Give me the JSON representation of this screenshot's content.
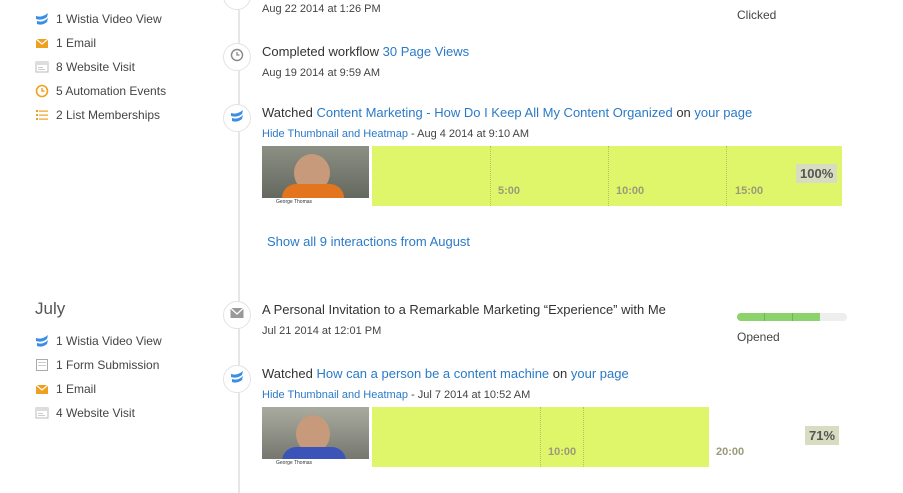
{
  "summary_august": [
    {
      "icon": "wistia-icon",
      "label": "1 Wistia Video View"
    },
    {
      "icon": "email-icon",
      "label": "1 Email"
    },
    {
      "icon": "website-visit-icon",
      "label": "8 Website Visit"
    },
    {
      "icon": "clock-icon",
      "label": "5 Automation Events"
    },
    {
      "icon": "list-icon",
      "label": "2 List Memberships"
    }
  ],
  "july": {
    "month": "July",
    "summary": [
      {
        "icon": "wistia-icon",
        "label": "1 Wistia Video View"
      },
      {
        "icon": "form-icon",
        "label": "1 Form Submission"
      },
      {
        "icon": "email-icon",
        "label": "1 Email"
      },
      {
        "icon": "website-visit-icon",
        "label": "4 Website Visit"
      }
    ]
  },
  "timeline": {
    "top_event": {
      "date": "Aug 22 2014 at 1:26 PM",
      "status": "Clicked"
    },
    "workflow": {
      "prefix": "Completed workflow",
      "link": "30 Page Views",
      "date": "Aug 19 2014 at 9:59 AM"
    },
    "video1": {
      "prefix": "Watched",
      "video_link": "Content Marketing - How Do I Keep All My Content Organized",
      "on": "on",
      "page_link": "your page",
      "hide_link": "Hide Thumbnail and Heatmap",
      "date": "- Aug 4 2014 at 9:10 AM",
      "thumb_name": "George Thomas",
      "ticks": [
        "5:00",
        "10:00",
        "15:00"
      ],
      "percent": "100%",
      "percent_value": 1.0
    },
    "show_all": "Show all 9 interactions from August",
    "email": {
      "subject": "A Personal Invitation to a Remarkable Marketing “Experience” with Me",
      "date": "Jul 21 2014 at 12:01 PM",
      "status": "Opened",
      "progress": 0.75
    },
    "video2": {
      "prefix": "Watched",
      "video_link": "How can a person be a content machine",
      "on": "on",
      "page_link": "your page",
      "hide_link": "Hide Thumbnail and Heatmap",
      "date": "- Jul 7 2014 at 10:52 AM",
      "thumb_name": "George Thomas",
      "ticks": [
        "10:00",
        "20:00"
      ],
      "percent": "71%",
      "percent_value": 0.71
    }
  },
  "colors": {
    "link": "#2a7ac8",
    "heatmap": "#e0f66a",
    "progress": "#8bd36a",
    "accent_orange": "#f0a020",
    "wistia_blue": "#3a8ee6"
  }
}
